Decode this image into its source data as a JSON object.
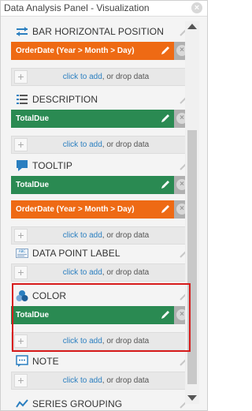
{
  "window": {
    "title": "Data Analysis Panel - Visualization",
    "close_glyph": "×"
  },
  "drop_zone": {
    "link": "click to add",
    "rest": ", or drop data",
    "plus": "+"
  },
  "sections": {
    "bar_position": {
      "label": "BAR HORIZONTAL POSITION",
      "icon": "horizontal-arrows-icon",
      "chips": [
        {
          "text": "OrderDate (Year > Month > Day)",
          "color": "#ee6a14"
        }
      ]
    },
    "description": {
      "label": "DESCRIPTION",
      "icon": "list-icon",
      "chips": [
        {
          "text": "TotalDue",
          "color": "#2a8a52"
        }
      ]
    },
    "tooltip": {
      "label": "TOOLTIP",
      "icon": "speech-bubble-icon",
      "chips": [
        {
          "text": "TotalDue",
          "color": "#2a8a52"
        },
        {
          "text": "OrderDate (Year > Month > Day)",
          "color": "#ee6a14"
        }
      ]
    },
    "data_point_label": {
      "label": "DATA POINT LABEL",
      "icon": "label-tag-icon",
      "icon_text": "ABC"
    },
    "color": {
      "label": "COLOR",
      "icon": "color-circles-icon",
      "chips": [
        {
          "text": "TotalDue",
          "color": "#2a8a52"
        }
      ]
    },
    "note": {
      "label": "NOTE",
      "icon": "note-bubble-icon"
    },
    "series_grouping": {
      "label": "SERIES GROUPING",
      "icon": "series-grouping-icon"
    }
  },
  "colors": {
    "accent_blue": "#2b7fc0",
    "highlight": "#d71a1a",
    "orange": "#ee6a14",
    "green": "#2a8a52"
  }
}
